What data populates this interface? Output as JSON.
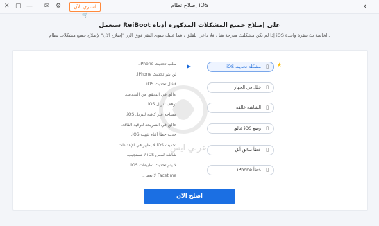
{
  "titlebar": {
    "title": "إصلاح نظام iOS",
    "back_icon": "back-arrow-icon",
    "buy_label": "اشتري الآن",
    "window_icons": [
      "minimize-icon",
      "maximize-icon",
      "settings-icon",
      "chat-icon",
      "close-icon"
    ]
  },
  "main": {
    "heading": "سيعمل ReiBoot على إصلاح جميع المشكلات المذكورة أدناه",
    "subheading": "إذا لم تكن مشكلتك مدرجة هنا ، فلا داعي للقلق ، فما عليك سوى النقر فوق الزر \"إصلاح الآن\" لإصلاح جميع مشكلات نظام iOS الخاصة بك بنقرة واحدة."
  },
  "issues": [
    "طلب تحديث iPhone.",
    "لن يتم تحديث iPhone.",
    "فشل تحديث iOS.",
    "عالق في التحقق من التحديث.",
    "توقف تنزيل iOS.",
    "مساحة غير كافية لتنزيل iOS.",
    "عالق في الشريحة لترقية الفاقة.",
    "حدث خطأ أثناء تثبيت iOS.",
    "تحديث iOS لا يظهر في الإعدادات.",
    "شاشة لمس iOS لا تستجيب.",
    "لا يتم تحديث تطبيقات iOS.",
    "Facetime لا تعمل."
  ],
  "options": [
    {
      "label": "iOS مشكلة تحديث",
      "icon": "ios-icon",
      "selected": true
    },
    {
      "label": "خلل في الجهاز",
      "icon": "phone-icon",
      "selected": false
    },
    {
      "label": "الشاشة عالقة",
      "icon": "screen-icon",
      "selected": false
    },
    {
      "label": "عالق iOS وضع",
      "icon": "ios-mode-icon",
      "selected": false
    },
    {
      "label": "خطأ سائق أبل",
      "icon": "apple-driver-icon",
      "selected": false
    },
    {
      "label": "iPhone خطأ",
      "icon": "iphone-error-icon",
      "selected": false
    }
  ],
  "fix_button": "اصلح الآن",
  "watermark_text": "عربي ايس",
  "accent_color": "#1b6fe3"
}
